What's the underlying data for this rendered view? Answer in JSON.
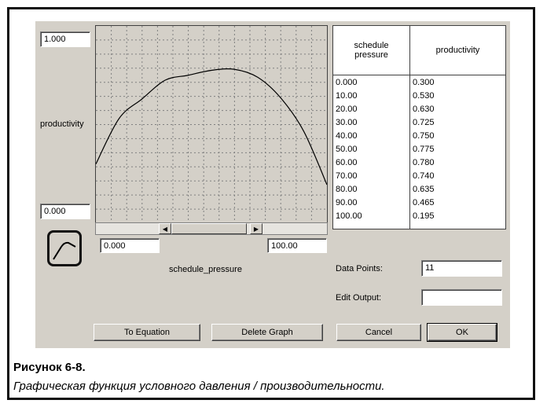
{
  "graph": {
    "y_max": "1.000",
    "y_min": "0.000",
    "x_min": "0.000",
    "x_max": "100.00",
    "y_label": "productivity",
    "x_label": "schedule_pressure"
  },
  "table": {
    "col1_header": "schedule\npressure",
    "col2_header": "productivity",
    "rows": [
      [
        "0.000",
        "0.300"
      ],
      [
        "10.00",
        "0.530"
      ],
      [
        "20.00",
        "0.630"
      ],
      [
        "30.00",
        "0.725"
      ],
      [
        "40.00",
        "0.750"
      ],
      [
        "50.00",
        "0.775"
      ],
      [
        "60.00",
        "0.780"
      ],
      [
        "70.00",
        "0.740"
      ],
      [
        "80.00",
        "0.635"
      ],
      [
        "90.00",
        "0.465"
      ],
      [
        "100.00",
        "0.195"
      ]
    ]
  },
  "data_points": {
    "label": "Data Points:",
    "value": "11"
  },
  "edit_output": {
    "label": "Edit Output:",
    "value": ""
  },
  "buttons": {
    "to_equation": "To Equation",
    "delete_graph": "Delete Graph",
    "cancel": "Cancel",
    "ok": "OK"
  },
  "caption": {
    "title": "Рисунок 6-8.",
    "text": "Графическая функция условного давления / производительности."
  },
  "chart_data": {
    "type": "line",
    "x": [
      0,
      10,
      20,
      30,
      40,
      50,
      60,
      70,
      80,
      90,
      100
    ],
    "y": [
      0.3,
      0.53,
      0.63,
      0.725,
      0.75,
      0.775,
      0.78,
      0.74,
      0.635,
      0.465,
      0.195
    ],
    "xlim": [
      0,
      100
    ],
    "ylim": [
      0,
      1
    ],
    "xlabel": "schedule_pressure",
    "ylabel": "productivity",
    "grid": true
  }
}
